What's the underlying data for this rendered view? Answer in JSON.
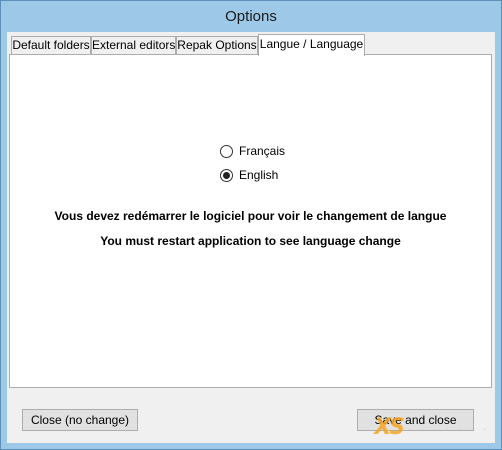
{
  "window": {
    "title": "Options"
  },
  "tabs": [
    {
      "label": "Default folders",
      "selected": false
    },
    {
      "label": "External editors",
      "selected": false
    },
    {
      "label": "Repak Options",
      "selected": false
    },
    {
      "label": "Langue / Language",
      "selected": true
    }
  ],
  "language": {
    "options": [
      {
        "label": "Français",
        "checked": false
      },
      {
        "label": "English",
        "checked": true
      }
    ],
    "message_fr": "Vous devez redémarrer le logiciel pour voir le changement de langue",
    "message_en": "You must restart application to see language change"
  },
  "buttons": {
    "close_label": "Close (no change)",
    "save_label": "Save and close"
  },
  "watermark": {
    "logo": "XS",
    "text": "· · · · · · ·"
  }
}
